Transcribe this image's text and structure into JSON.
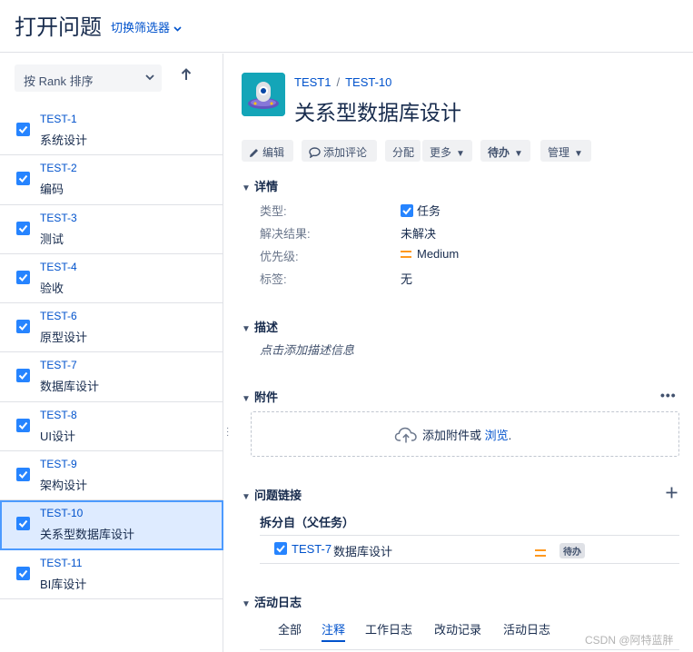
{
  "header": {
    "title": "打开问题",
    "filter_switch": "切换筛选器"
  },
  "sidebar": {
    "sort_label": "按 Rank 排序",
    "issues": [
      {
        "key": "TEST-1",
        "summary": "系统设计"
      },
      {
        "key": "TEST-2",
        "summary": "编码"
      },
      {
        "key": "TEST-3",
        "summary": "测试"
      },
      {
        "key": "TEST-4",
        "summary": "验收"
      },
      {
        "key": "TEST-6",
        "summary": "原型设计"
      },
      {
        "key": "TEST-7",
        "summary": "数据库设计"
      },
      {
        "key": "TEST-8",
        "summary": "UI设计"
      },
      {
        "key": "TEST-9",
        "summary": "架构设计"
      },
      {
        "key": "TEST-10",
        "summary": "关系型数据库设计",
        "selected": true
      },
      {
        "key": "TEST-11",
        "summary": "BI库设计"
      }
    ]
  },
  "issue": {
    "breadcrumb": {
      "project": "TEST1",
      "sep": "/",
      "key": "TEST-10"
    },
    "title": "关系型数据库设计",
    "toolbar": {
      "edit": "编辑",
      "comment": "添加评论",
      "assign": "分配",
      "more": "更多",
      "status": "待办",
      "admin": "管理"
    },
    "details": {
      "heading": "详情",
      "fields": [
        {
          "label": "类型:",
          "value": "任务"
        },
        {
          "label": "解决结果:",
          "value": "未解决"
        },
        {
          "label": "优先级:",
          "value": "Medium"
        },
        {
          "label": "标签:",
          "value": "无"
        }
      ]
    },
    "description": {
      "heading": "描述",
      "placeholder": "点击添加描述信息"
    },
    "attachments": {
      "heading": "附件",
      "drop_text": "添加附件或 ",
      "browse": "浏览",
      "period": "."
    },
    "links": {
      "heading": "问题链接",
      "group": "拆分自（父任务）",
      "items": [
        {
          "key": "TEST-7",
          "summary": "数据库设计",
          "status": "待办"
        }
      ]
    },
    "activity": {
      "heading": "活动日志",
      "tabs": [
        "全部",
        "注释",
        "工作日志",
        "改动记录",
        "活动日志"
      ],
      "active_tab": "注释"
    }
  },
  "watermark": "CSDN @阿特蓝胖",
  "colors": {
    "link": "#0052cc",
    "checkbox": "#2684ff",
    "priority_medium": "#ff991f",
    "selected_bg": "#deebff",
    "avatar_bg": "#14a5b8"
  }
}
